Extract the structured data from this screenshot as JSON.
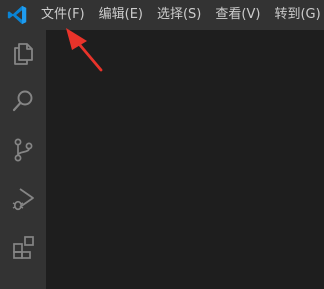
{
  "app": {
    "logo_icon": "vscode-logo-icon",
    "accent": "#0a84d4"
  },
  "menubar": {
    "items": [
      {
        "label": "文件(F)"
      },
      {
        "label": "编辑(E)"
      },
      {
        "label": "选择(S)"
      },
      {
        "label": "查看(V)"
      },
      {
        "label": "转到(G)"
      }
    ]
  },
  "activitybar": {
    "items": [
      {
        "icon": "explorer-icon"
      },
      {
        "icon": "search-icon"
      },
      {
        "icon": "source-control-icon"
      },
      {
        "icon": "run-debug-icon"
      },
      {
        "icon": "extensions-icon"
      }
    ]
  },
  "annotation": {
    "icon": "red-arrow-icon",
    "color": "#e8332a"
  },
  "colors": {
    "titlebar": "#333333",
    "activitybar": "#333333",
    "editor": "#1e1e1e",
    "icon": "#858585",
    "menu_text": "#cccccc"
  }
}
